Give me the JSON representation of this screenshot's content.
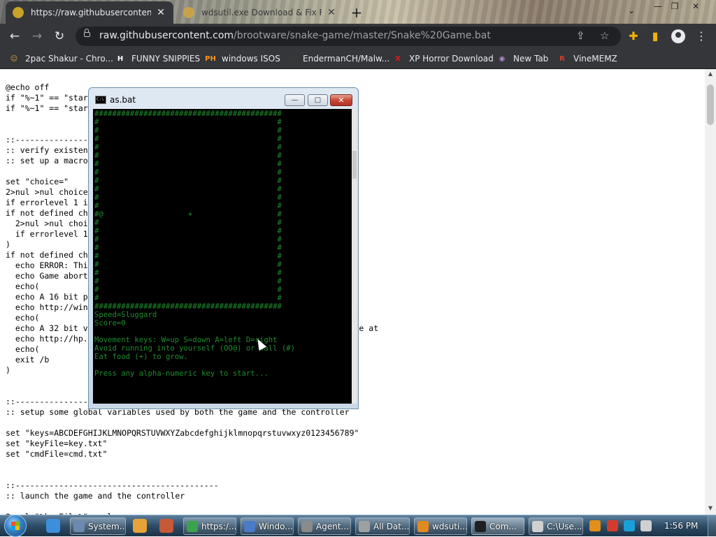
{
  "browser": {
    "tabs": [
      {
        "title": "https://raw.githubusercontent.com/brootware/snake-game/master/Snake%20Game.bat",
        "close": "✕"
      },
      {
        "title": "wdsutil.exe Download & Fix For Windows",
        "close": "✕"
      }
    ],
    "new_tab": "+",
    "tab_search": "⌄",
    "window_controls": {
      "minimize": "—",
      "restore": "❐",
      "close": "✕"
    },
    "nav": {
      "back": "←",
      "forward": "→",
      "reload": "↻"
    },
    "url_host": "raw.githubusercontent.com",
    "url_path": "/brootware/snake-game/master/Snake%20Game.bat",
    "icons": {
      "share": "⇪",
      "star": "☆",
      "extensions": "✚",
      "sidebar": "▮",
      "menu": "⋮"
    }
  },
  "bookmarks": [
    {
      "label": "2pac Shakur - Chro...",
      "icon": "☺",
      "color": "#d9a43a"
    },
    {
      "label": "FUNNY SNIPPIES",
      "icon": "H",
      "color": "#ffffff"
    },
    {
      "label": "windows ISOS",
      "icon": "PH",
      "color": "#f7971d"
    },
    {
      "label": "EndermanCH/Malw...",
      "icon": "YP",
      "color": "#3a3a3a"
    },
    {
      "label": "XP Horror Download",
      "icon": "X",
      "color": "#e21b1b"
    },
    {
      "label": "New Tab",
      "icon": "◉",
      "color": "#b08ad0"
    },
    {
      "label": "VineMEMZ",
      "icon": "R",
      "color": "#d33b2c"
    }
  ],
  "page": {
    "code_lines": [
      "@echo off",
      "if \"%~1\" == \"startGame\" goto :game",
      "if \"%~1\" == \"startController\" goto :controller",
      "",
      "",
      "::---------------------------------------------------------------------",
      ":: verify existence of CHOICE command",
      ":: set up a macro appropriate for the version",
      "",
      "set \"choice=\"",
      "2>nul >nul choice /c:yn /t:y,1",
      "if errorlevel 1 if not errorlevel 2 set \"choice=choice /cs /n /c:\"",
      "if not defined choice (",
      "  2>nul >nul choice /c:yn /t 1 /d y",
      "  if errorlevel 1 if not errorlevel 2 set \"choice=choice /cs /n /t 1 /d\"",
      ")",
      "if not defined choice (",
      "  echo ERROR: This game requires the CHOICE command, but it is missing.",
      "  echo Game aborted. :(",
      "  echo(",
      "  echo A 16 bit port of CHOICE.EXE from FREEDOS is available at",
      "  echo http://winsupport.org/utilities/freedos-choice.html",
      "  echo(",
      "  echo A 32 bit version from ??? suitable for 64 bit machines is available at",
      "  echo http://hp.vector.co.jp/authors/VA007219/dkclonesup/choice.html",
      "  echo(",
      "  exit /b",
      ")",
      "",
      "",
      "::---------------------------------------------------------------------",
      ":: setup some global variables used by both the game and the controller",
      "",
      "set \"keys=ABCDEFGHIJKLMNOPQRSTUVWXYZabcdefghijklmnopqrstuvwxyz0123456789\"",
      "set \"keyFile=key.txt\"",
      "set \"cmdFile=cmd.txt\"",
      "",
      "",
      "::------------------------------------------",
      ":: launch the game and the controller",
      "",
      "2>nul \"%keyFile%\" >nul"
    ],
    "scroll_up": "▲",
    "scroll_down": "▼"
  },
  "console": {
    "title": "as.bat",
    "icon_text": "C:\\",
    "buttons": {
      "minimize": "—",
      "maximize": "□",
      "close": "✕"
    },
    "screen_lines": [
      "##########################################",
      "#                                        #",
      "#                                        #",
      "#                                        #",
      "#                                        #",
      "#                                        #",
      "#                                        #",
      "#                                        #",
      "#                                        #",
      "#                                        #",
      "#                                        #",
      "#                                        #",
      "#@                   +                   #",
      "#                                        #",
      "#                                        #",
      "#                                        #",
      "#                                        #",
      "#                                        #",
      "#                                        #",
      "#                                        #",
      "#                                        #",
      "#                                        #",
      "#                                        #",
      "##########################################",
      "Speed=Sluggard",
      "Score=0",
      "",
      "Movement keys: W=up S=down A=left D=right",
      "Avoid running into yourself (OO@) or wall (#)",
      "Eat food (+) to grow.",
      "",
      "Press any alpha-numeric key to start..."
    ]
  },
  "taskbar": {
    "quick_launch": [
      {
        "name": "ie",
        "color": "#3c8fdc"
      },
      {
        "name": "media",
        "color": "#e8a23a"
      },
      {
        "name": "gimp",
        "color": "#c45a3a"
      }
    ],
    "items": [
      {
        "label": "System...",
        "color": "#6a8ab0",
        "active": false
      },
      {
        "label": "https:/...",
        "color": "#3aa24a",
        "active": false
      },
      {
        "label": "Windo...",
        "color": "#4a7ac8",
        "active": false
      },
      {
        "label": "Agent...",
        "color": "#8a8a8a",
        "active": false
      },
      {
        "label": "All Dat...",
        "color": "#a0a0a0",
        "active": false
      },
      {
        "label": "wdsuti...",
        "color": "#e08a20",
        "active": false
      },
      {
        "label": "Com...",
        "color": "#202020",
        "active": true
      },
      {
        "label": "C:\\Use...",
        "color": "#d0d0d0",
        "active": false
      }
    ],
    "tray": [
      {
        "name": "search-tray",
        "color": "#e0901a"
      },
      {
        "name": "flag-tray",
        "color": "#d33b2c"
      },
      {
        "name": "display-tray",
        "color": "#1aa0d8"
      },
      {
        "name": "volume-tray",
        "color": "#d0d0d0"
      }
    ],
    "clock": "1:56 PM"
  }
}
